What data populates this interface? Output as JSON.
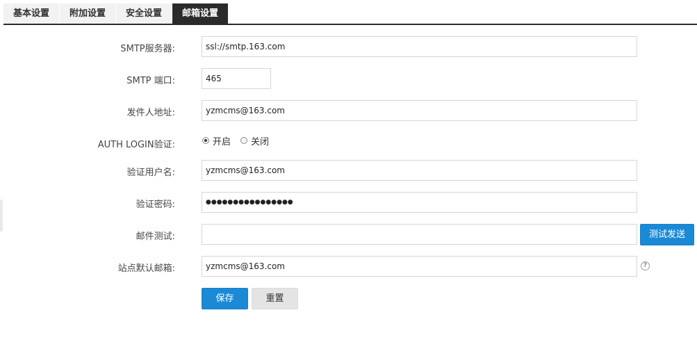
{
  "tabs": [
    {
      "label": "基本设置",
      "active": false
    },
    {
      "label": "附加设置",
      "active": false
    },
    {
      "label": "安全设置",
      "active": false
    },
    {
      "label": "邮箱设置",
      "active": true
    }
  ],
  "form": {
    "smtp_server": {
      "label": "SMTP服务器:",
      "value": "ssl://smtp.163.com"
    },
    "smtp_port": {
      "label": "SMTP 端口:",
      "value": "465"
    },
    "sender_address": {
      "label": "发件人地址:",
      "value": "yzmcms@163.com"
    },
    "auth_login": {
      "label": "AUTH LOGIN验证:",
      "options": [
        {
          "label": "开启",
          "checked": true
        },
        {
          "label": "关闭",
          "checked": false
        }
      ]
    },
    "auth_username": {
      "label": "验证用户名:",
      "value": "yzmcms@163.com"
    },
    "auth_password": {
      "label": "验证密码:",
      "value": "●●●●●●●●●●●●●●●●"
    },
    "mail_test": {
      "label": "邮件测试:",
      "value": "",
      "button": "测试发送"
    },
    "default_mailbox": {
      "label": "站点默认邮箱:",
      "value": "yzmcms@163.com",
      "help_icon": "question-circle-icon"
    }
  },
  "actions": {
    "save": "保存",
    "reset": "重置"
  },
  "colors": {
    "active_tab_bg": "#2b2b2b",
    "primary_button": "#1a8ad6",
    "default_button": "#e4e4e4"
  }
}
